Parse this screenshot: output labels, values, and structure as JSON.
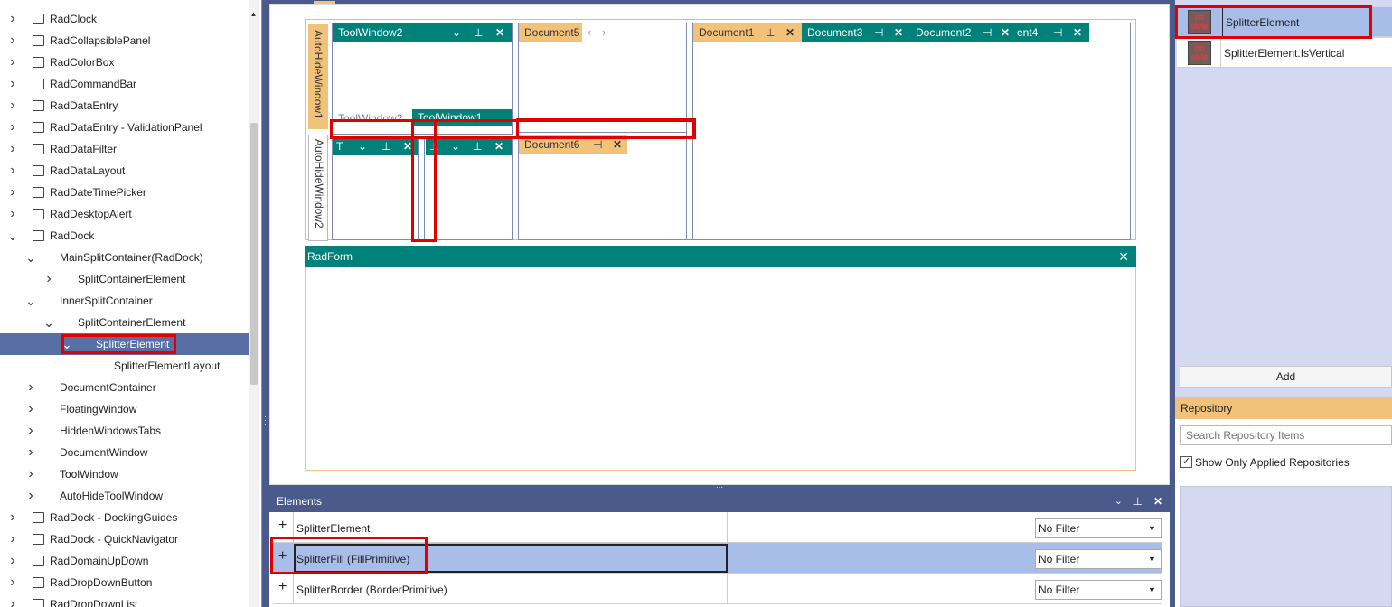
{
  "tree": {
    "items": [
      {
        "label": "RadClock",
        "indent": 0,
        "expander": ">",
        "icon": "clock-icon"
      },
      {
        "label": "RadCollapsiblePanel",
        "indent": 0,
        "expander": ">",
        "icon": "panel-icon"
      },
      {
        "label": "RadColorBox",
        "indent": 0,
        "expander": ">",
        "icon": "color-icon"
      },
      {
        "label": "RadCommandBar",
        "indent": 0,
        "expander": ">",
        "icon": "commandbar-icon"
      },
      {
        "label": "RadDataEntry",
        "indent": 0,
        "expander": ">",
        "icon": "grid-icon"
      },
      {
        "label": "RadDataEntry - ValidationPanel",
        "indent": 0,
        "expander": ">",
        "icon": "grid-icon"
      },
      {
        "label": "RadDataFilter",
        "indent": 0,
        "expander": ">",
        "icon": "filter-icon"
      },
      {
        "label": "RadDataLayout",
        "indent": 0,
        "expander": ">",
        "icon": "grid-icon"
      },
      {
        "label": "RadDateTimePicker",
        "indent": 0,
        "expander": ">",
        "icon": "calendar-icon"
      },
      {
        "label": "RadDesktopAlert",
        "indent": 0,
        "expander": ">",
        "icon": "alert-icon"
      },
      {
        "label": "RadDock",
        "indent": 0,
        "expander": "v",
        "icon": "dock-icon"
      },
      {
        "label": "MainSplitContainer(RadDock)",
        "indent": 1,
        "expander": "v",
        "icon": ""
      },
      {
        "label": "SplitContainerElement",
        "indent": 2,
        "expander": ">",
        "icon": ""
      },
      {
        "label": "InnerSplitContainer",
        "indent": 1,
        "expander": "v",
        "icon": ""
      },
      {
        "label": "SplitContainerElement",
        "indent": 2,
        "expander": "v",
        "icon": ""
      },
      {
        "label": "SplitterElement",
        "indent": 3,
        "expander": "v",
        "icon": "",
        "selected": true
      },
      {
        "label": "SplitterElementLayout",
        "indent": 4,
        "expander": "",
        "icon": ""
      },
      {
        "label": "DocumentContainer",
        "indent": 1,
        "expander": ">",
        "icon": ""
      },
      {
        "label": "FloatingWindow",
        "indent": 1,
        "expander": ">",
        "icon": ""
      },
      {
        "label": "HiddenWindowsTabs",
        "indent": 1,
        "expander": ">",
        "icon": ""
      },
      {
        "label": "DocumentWindow",
        "indent": 1,
        "expander": ">",
        "icon": ""
      },
      {
        "label": "ToolWindow",
        "indent": 1,
        "expander": ">",
        "icon": ""
      },
      {
        "label": "AutoHideToolWindow",
        "indent": 1,
        "expander": ">",
        "icon": ""
      },
      {
        "label": "RadDock - DockingGuides",
        "indent": 0,
        "expander": ">",
        "icon": "grid-icon"
      },
      {
        "label": "RadDock - QuickNavigator",
        "indent": 0,
        "expander": ">",
        "icon": "grid-icon"
      },
      {
        "label": "RadDomainUpDown",
        "indent": 0,
        "expander": ">",
        "icon": "updown-icon"
      },
      {
        "label": "RadDropDownButton",
        "indent": 0,
        "expander": ">",
        "icon": "dropdown-icon"
      },
      {
        "label": "RadDropDownList",
        "indent": 0,
        "expander": ">",
        "icon": "dropdown-icon"
      }
    ]
  },
  "designer": {
    "autohide1": "AutoHideWindow1",
    "autohide2": "AutoHideWindow2",
    "toolwindow2_title": "ToolWindow2",
    "toolwindow2_tab": "ToolWindow2",
    "toolwindow1_tab": "ToolWindow1",
    "lower_left_title": "T",
    "document5": "Document5",
    "document6": "Document6",
    "document1": "Document1",
    "document3": "Document3",
    "document2": "Document2",
    "document4_partial": "ent4",
    "radform_title": "RadForm"
  },
  "styles": {
    "rows": [
      {
        "badge": "no style",
        "label": "SplitterElement"
      },
      {
        "badge": "no style",
        "label": "SplitterElement.IsVertical"
      }
    ],
    "add_label": "Add"
  },
  "repository": {
    "title": "Repository",
    "search_placeholder": "Search Repository Items",
    "show_applied_label": "Show Only Applied Repositories",
    "show_applied_checked": true
  },
  "elements": {
    "title": "Elements",
    "rows": [
      {
        "name": "SplitterElement",
        "filter": "No Filter"
      },
      {
        "name": "SplitterFill (FillPrimitive)",
        "filter": "No Filter"
      },
      {
        "name": "SplitterBorder (BorderPrimitive)",
        "filter": "No Filter"
      }
    ]
  },
  "colors": {
    "teal": "#00827a",
    "orange": "#f2c27a",
    "selection": "#5a6ea6",
    "highlight_box": "#e00000"
  }
}
